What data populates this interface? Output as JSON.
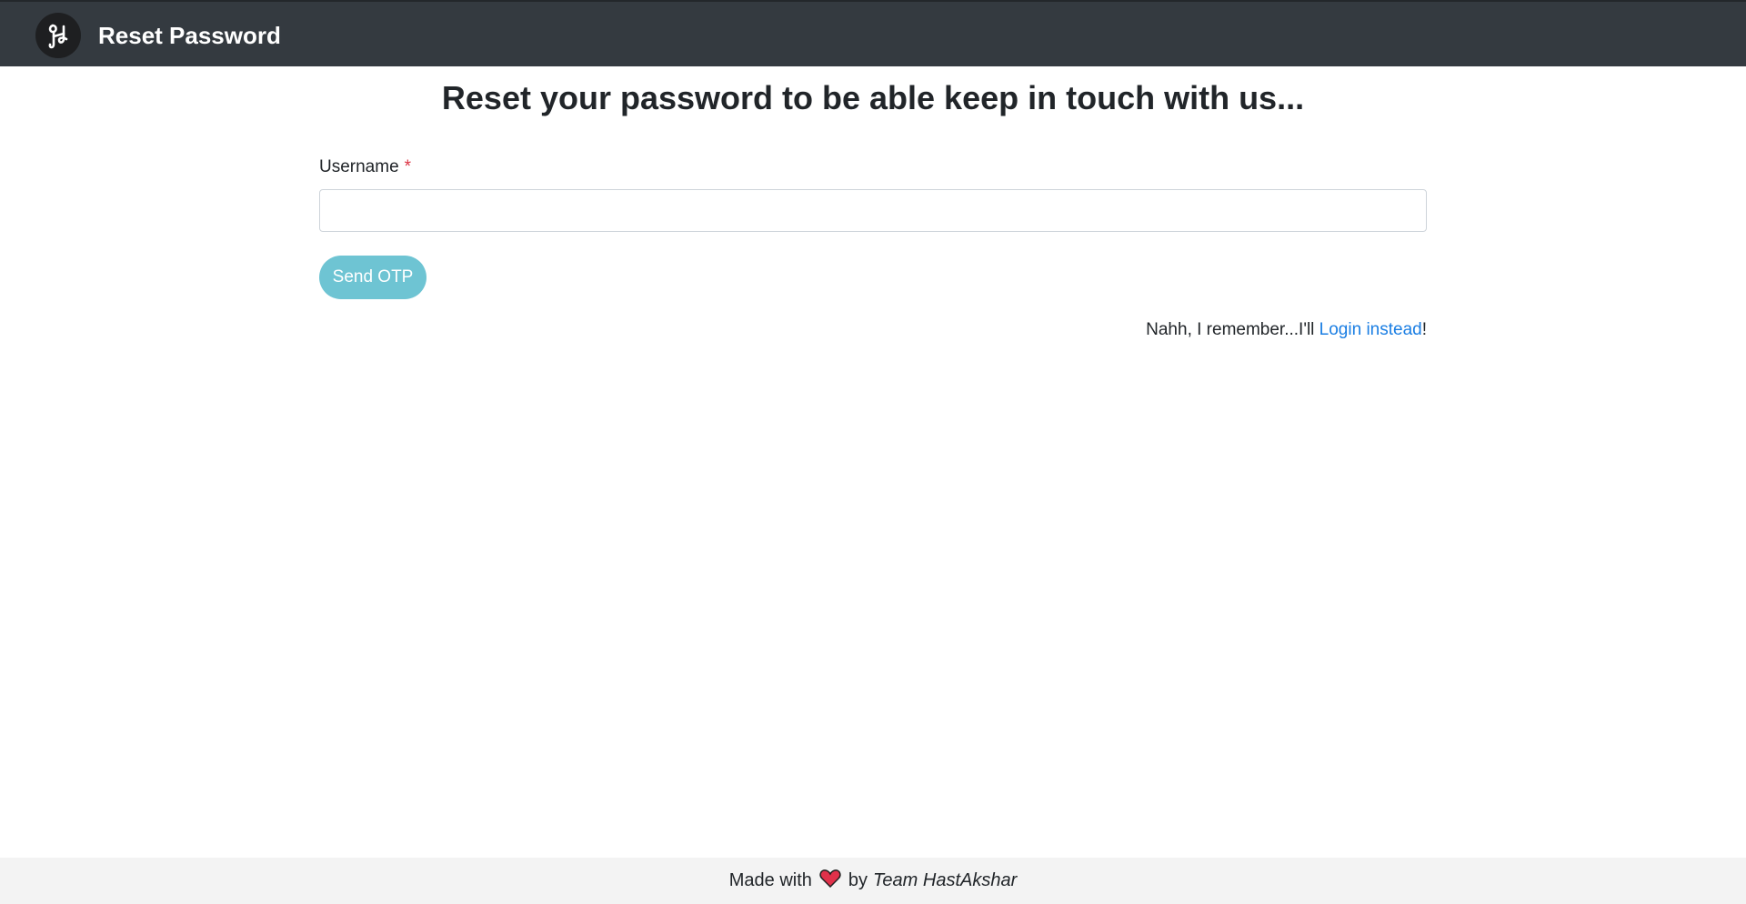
{
  "navbar": {
    "logo_icon": "hastakshar-logo-icon",
    "title": "Reset Password"
  },
  "main": {
    "heading": "Reset your password to be able keep in touch with us...",
    "username_label": "Username",
    "required_marker": "*",
    "username_value": "",
    "username_placeholder": "",
    "send_button_label": "Send OTP",
    "alt_prefix": "Nahh, I remember...I'll ",
    "login_link_label": "Login instead",
    "alt_suffix": "!"
  },
  "footer": {
    "made_with": "Made with",
    "heart_icon": "heart-icon",
    "by": "by",
    "team": "Team HastAkshar"
  },
  "colors": {
    "navbar_bg": "#343a40",
    "button_bg": "#6ec4d3",
    "link": "#1a7ee3",
    "required": "#dc3545",
    "heart": "#e0314a",
    "footer_bg": "#f3f3f3"
  }
}
